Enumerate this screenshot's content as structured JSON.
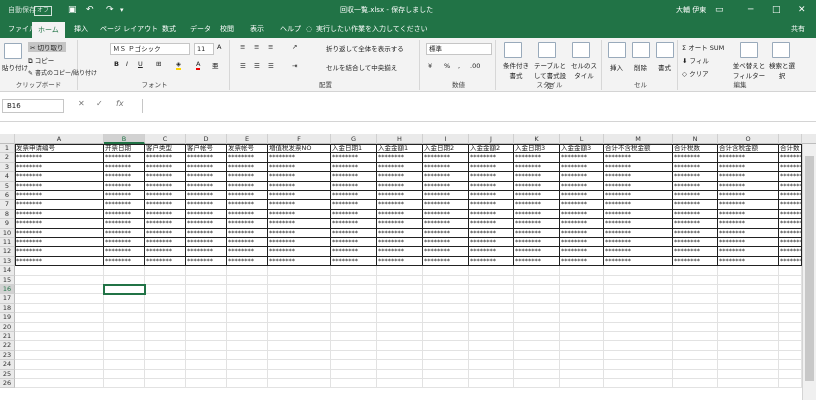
{
  "window": {
    "autosave": "自動保存",
    "autosave_state": "オフ",
    "title": "回収一覧.xlsx - 保存しました",
    "user": "大輔 伊東"
  },
  "tabs": [
    "ファイル",
    "ホーム",
    "挿入",
    "ページ レイアウト",
    "数式",
    "データ",
    "校閲",
    "表示",
    "ヘルプ"
  ],
  "tell_me": "実行したい作業を入力してください",
  "share": "共有",
  "ribbon": {
    "clipboard": {
      "paste": "貼り付け",
      "cut": "切り取り",
      "copy": "コピー",
      "format_painter": "書式のコピー/貼り付け",
      "label": "クリップボード"
    },
    "font": {
      "name": "ＭＳ Ｐゴシック",
      "size": "11",
      "label": "フォント"
    },
    "alignment": {
      "wrap": "折り返して全体を表示する",
      "merge": "セルを結合して中央揃え",
      "label": "配置"
    },
    "number": {
      "format": "標準",
      "label": "数値"
    },
    "styles": {
      "cond": "条件付き書式",
      "table": "テーブルとして書式設定",
      "cell": "セルのスタイル",
      "label": "スタイル"
    },
    "cells": {
      "insert": "挿入",
      "delete": "削除",
      "format": "書式",
      "label": "セル"
    },
    "editing": {
      "autosum": "オート SUM",
      "fill": "フィル",
      "clear": "クリア",
      "sort": "並べ替えとフィルター",
      "find": "検索と選択",
      "label": "編集"
    }
  },
  "namebox": "B16",
  "columns": [
    "A",
    "B",
    "C",
    "D",
    "E",
    "F",
    "G",
    "H",
    "I",
    "J",
    "K",
    "L",
    "M",
    "N",
    "O",
    ""
  ],
  "header_row": [
    "发票申请编号",
    "开票日期",
    "客户类型",
    "客户帐号",
    "发票帐号",
    "増值税发票NO",
    "入金日期1",
    "入金金額1",
    "入金日期2",
    "入金金額2",
    "入金日期3",
    "入金金額3",
    "合计不含税金额",
    "合计税数",
    "合计含税金额",
    "合计数"
  ],
  "masked": "********",
  "row_numbers": [
    "1",
    "2",
    "3",
    "4",
    "5",
    "6",
    "7",
    "8",
    "9",
    "10",
    "11",
    "12",
    "13",
    "14",
    "15",
    "16",
    "17",
    "18",
    "19",
    "20",
    "21",
    "22",
    "23",
    "24",
    "25",
    "26"
  ]
}
